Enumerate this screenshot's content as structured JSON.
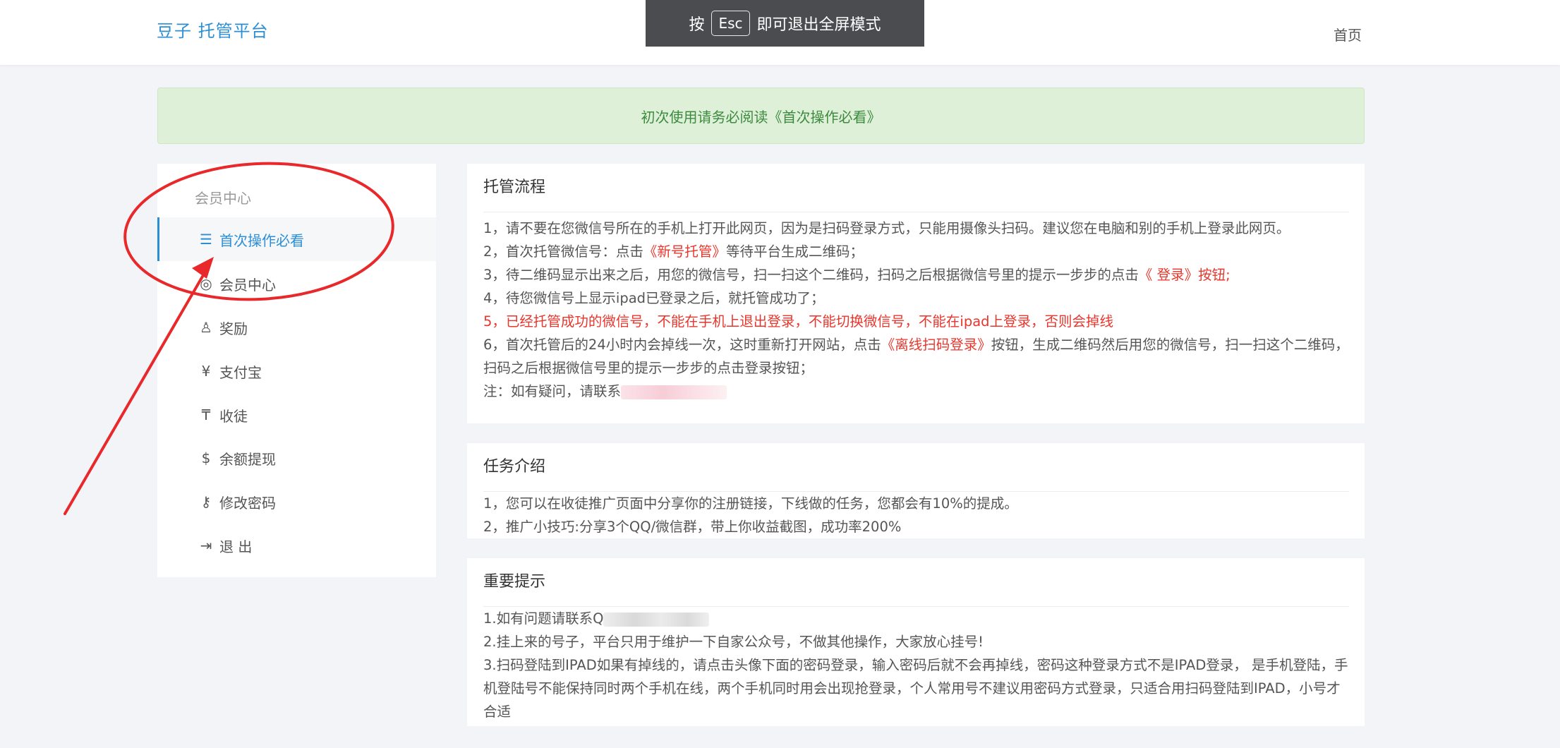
{
  "header": {
    "brand": "豆子 托管平台",
    "nav_home": "首页"
  },
  "esc_tip": {
    "prefix": "按",
    "key": "Esc",
    "suffix": "即可退出全屏模式"
  },
  "alert": {
    "text": "初次使用请务必阅读《首次操作必看》"
  },
  "sidebar": {
    "heading": "会员中心",
    "items": [
      {
        "label": "首次操作必看",
        "icon": "list-icon",
        "glyph": "☰",
        "active": true
      },
      {
        "label": "会员中心",
        "icon": "user-circle-icon",
        "glyph": "◎",
        "active": false
      },
      {
        "label": "奖励",
        "icon": "user-icon",
        "glyph": "♙",
        "active": false
      },
      {
        "label": "支付宝",
        "icon": "yen-icon",
        "glyph": "¥",
        "active": false
      },
      {
        "label": "收徒",
        "icon": "rmb-icon",
        "glyph": "₸",
        "active": false
      },
      {
        "label": "余额提现",
        "icon": "dollar-icon",
        "glyph": "$",
        "active": false
      },
      {
        "label": "修改密码",
        "icon": "key-icon",
        "glyph": "⚷",
        "active": false
      },
      {
        "label": "退 出",
        "icon": "logout-icon",
        "glyph": "⇥",
        "active": false
      }
    ]
  },
  "panels": {
    "flow": {
      "title": "托管流程",
      "line1": "1，请不要在您微信号所在的手机上打开此网页，因为是扫码登录方式，只能用摄像头扫码。建议您在电脑和别的手机上登录此网页。",
      "line2_a": "2，首次托管微信号：点击",
      "line2_b": "《新号托管》",
      "line2_c": "等待平台生成二维码；",
      "line3_a": "3，待二维码显示出来之后，用您的微信号，扫一扫这个二维码，扫码之后根据微信号里的提示一步步的点击",
      "line3_b": "《 登录》按钮;",
      "line4": "4，待您微信号上显示ipad已登录之后，就托管成功了；",
      "line5": "5，已经托管成功的微信号，不能在手机上退出登录，不能切换微信号，不能在ipad上登录，否则会掉线",
      "line6_a": "6，首次托管后的24小时内会掉线一次，这时重新打开网站，点击",
      "line6_b": "《离线扫码登录》",
      "line6_c": "按钮，生成二维码然后用您的微信号，扫一扫这个二维码，扫码之后根据微信号里的提示一步步的点击登录按钮；",
      "note": "注：如有疑问，请联系"
    },
    "task": {
      "title": "任务介绍",
      "line1": "1，您可以在收徒推广页面中分享你的注册链接，下线做的任务，您都会有10%的提成。",
      "line2": "2，推广小技巧:分享3个QQ/微信群，带上你收益截图，成功率200%"
    },
    "important": {
      "title": "重要提示",
      "line1": "1.如有问题请联系Q",
      "line2": "2.挂上来的号子，平台只用于维护一下自家公众号，不做其他操作，大家放心挂号!",
      "line3": "3.扫码登陆到IPAD如果有掉线的，请点击头像下面的密码登录，输入密码后就不会再掉线，密码这种登录方式不是IPAD登录， 是手机登陆，手机登陆号不能保持同时两个手机在线，两个手机同时用会出现抢登录，个人常用号不建议用密码方式登录，只适合用扫码登陆到IPAD，小号才合适"
    }
  },
  "colors": {
    "accent": "#2c8fd6",
    "alert_bg": "#dff0d8",
    "alert_text": "#3c8a3f",
    "emphasis_red": "#e8362c",
    "annotation_red": "#e8282a"
  }
}
